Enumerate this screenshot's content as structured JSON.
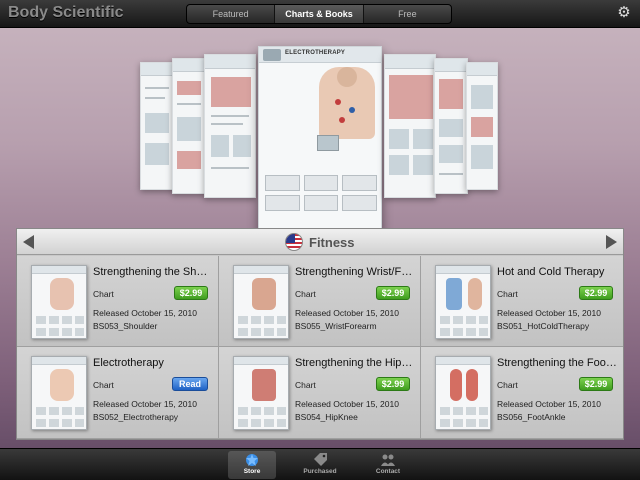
{
  "app": {
    "title": "Body Scientific"
  },
  "segments": [
    {
      "label": "Featured",
      "active": false
    },
    {
      "label": "Charts & Books",
      "active": true
    },
    {
      "label": "Free",
      "active": false
    }
  ],
  "banner": {
    "featured_chart_title": "ELECTROTHERAPY"
  },
  "category": {
    "name": "Fitness",
    "icon": "us-flag-icon"
  },
  "products": [
    {
      "title": "Strengthening the Shoulder",
      "type": "Chart",
      "action": "$2.99",
      "released": "Released October 15, 2010",
      "sku": "BS053_Shoulder"
    },
    {
      "title": "Strengthening Wrist/Forearm",
      "type": "Chart",
      "action": "$2.99",
      "released": "Released October 15, 2010",
      "sku": "BS055_WristForearm"
    },
    {
      "title": "Hot and Cold Therapy",
      "type": "Chart",
      "action": "$2.99",
      "released": "Released October 15, 2010",
      "sku": "BS051_HotColdTherapy"
    },
    {
      "title": "Electrotherapy",
      "type": "Chart",
      "action": "Read",
      "released": "Released October 15, 2010",
      "sku": "BS052_Electrotherapy"
    },
    {
      "title": "Strengthening the Hip/Knee",
      "type": "Chart",
      "action": "$2.99",
      "released": "Released October 15, 2010",
      "sku": "BS054_HipKnee"
    },
    {
      "title": "Strengthening the Foot/Ankle",
      "type": "Chart",
      "action": "$2.99",
      "released": "Released October 15, 2010",
      "sku": "BS056_FootAnkle"
    }
  ],
  "tabs": [
    {
      "label": "Store",
      "icon": "star-icon",
      "active": true
    },
    {
      "label": "Purchased",
      "icon": "price-tag-icon",
      "active": false
    },
    {
      "label": "Contact",
      "icon": "contacts-icon",
      "active": false
    }
  ],
  "colors": {
    "price_button": "#3f9d1f",
    "read_button": "#1f62c5",
    "bar_dark": "#161616"
  }
}
